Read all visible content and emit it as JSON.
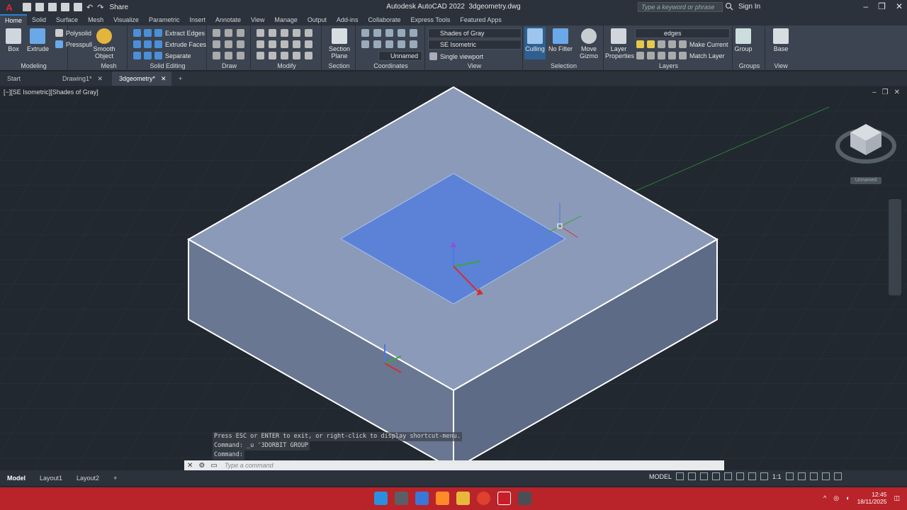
{
  "titlebar": {
    "app_title": "Autodesk AutoCAD 2022",
    "file": "3dgeometry.dwg",
    "share": "Share",
    "search_placeholder": "Type a keyword or phrase",
    "signin": "Sign In"
  },
  "ribbon_tabs": [
    "Home",
    "Solid",
    "Surface",
    "Mesh",
    "Visualize",
    "Parametric",
    "Insert",
    "Annotate",
    "View",
    "Manage",
    "Output",
    "Add-ins",
    "Collaborate",
    "Express Tools",
    "Featured Apps"
  ],
  "ribbon": {
    "modeling": {
      "title": "Modeling",
      "box": "Box",
      "extrude": "Extrude",
      "polysolid": "Polysolid",
      "presspull": "Presspull"
    },
    "mesh": {
      "title": "Mesh",
      "smooth": "Smooth Object"
    },
    "solid_editing": {
      "title": "Solid Editing",
      "extract": "Extract Edges",
      "extrude_faces": "Extrude Faces",
      "separate": "Separate"
    },
    "draw": {
      "title": "Draw"
    },
    "modify": {
      "title": "Modify"
    },
    "section": {
      "title": "Section",
      "plane": "Section Plane"
    },
    "coordinates": {
      "title": "Coordinates",
      "ucs": "Unnamed"
    },
    "view": {
      "title": "View",
      "visual_style": "Shades of Gray",
      "view_name": "SE Isometric",
      "viewport": "Single viewport"
    },
    "selection": {
      "title": "Selection",
      "culling": "Culling",
      "nofilter": "No Filter",
      "gizmo": "Move Gizmo"
    },
    "layers": {
      "title": "Layers",
      "props": "Layer Properties",
      "layer": "edges",
      "make_current": "Make Current",
      "match": "Match Layer"
    },
    "groups": {
      "title": "Groups",
      "group": "Group"
    },
    "view2": {
      "title": "View",
      "base": "Base"
    }
  },
  "doc_tabs": [
    "Start",
    "Drawing1*",
    "3dgeometry*"
  ],
  "viewport": {
    "label": "[−][SE Isometric][Shades of Gray]",
    "viewcube_label": "Unnamed"
  },
  "command": {
    "line1": "Press ESC or ENTER to exit, or right-click to display shortcut-menu.",
    "line2": "Command: _u '3DORBIT GROUP",
    "line3": "Command:",
    "placeholder": "Type a command"
  },
  "layout_tabs": [
    "Model",
    "Layout1",
    "Layout2"
  ],
  "status": {
    "model": "MODEL",
    "scale": "1:1"
  },
  "clock": {
    "time": "12:45",
    "date": "18/11/2025"
  },
  "colors": {
    "accent": "#2e7fd0",
    "taskbar": "#b9232a",
    "face": "#8a9bbd",
    "selected_face": "#5b82d6"
  }
}
